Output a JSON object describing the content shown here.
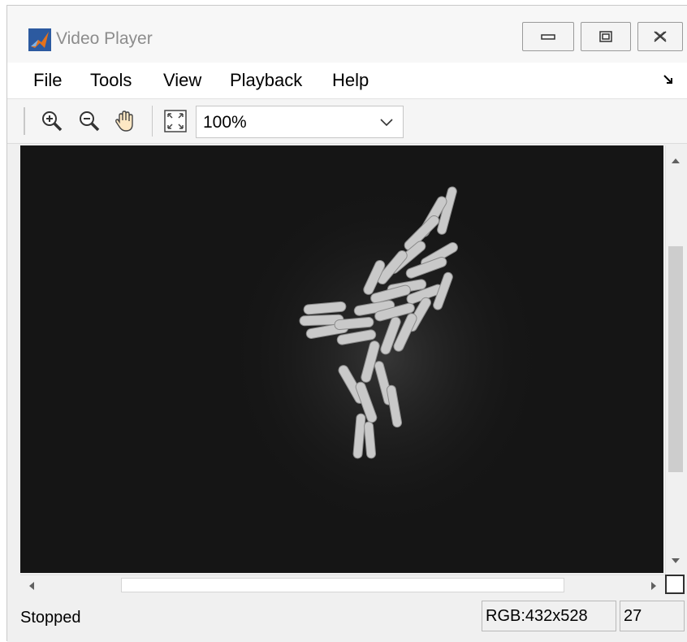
{
  "window": {
    "title": "Video Player",
    "app_icon": "matlab-logo-icon",
    "controls": [
      "minimize-icon",
      "maximize-icon",
      "close-icon"
    ]
  },
  "menu": {
    "items": [
      "File",
      "Tools",
      "View",
      "Playback",
      "Help"
    ],
    "corner_icon": "undock-arrow-icon"
  },
  "toolbar": {
    "icons": [
      "zoom-in-icon",
      "zoom-out-icon",
      "pan-hand-icon",
      "fit-to-window-icon"
    ],
    "zoom": {
      "value": "100%",
      "icon": "chevron-down-icon"
    }
  },
  "video": {
    "description_icon": "video-frame",
    "background_color": "#141414"
  },
  "status": {
    "state": "Stopped",
    "resolution": "RGB:432x528",
    "frame": "27"
  },
  "colors": {
    "title_text": "#8c8c8c",
    "matlab_orange": "#e5721c",
    "matlab_blue": "#1a66c2"
  }
}
